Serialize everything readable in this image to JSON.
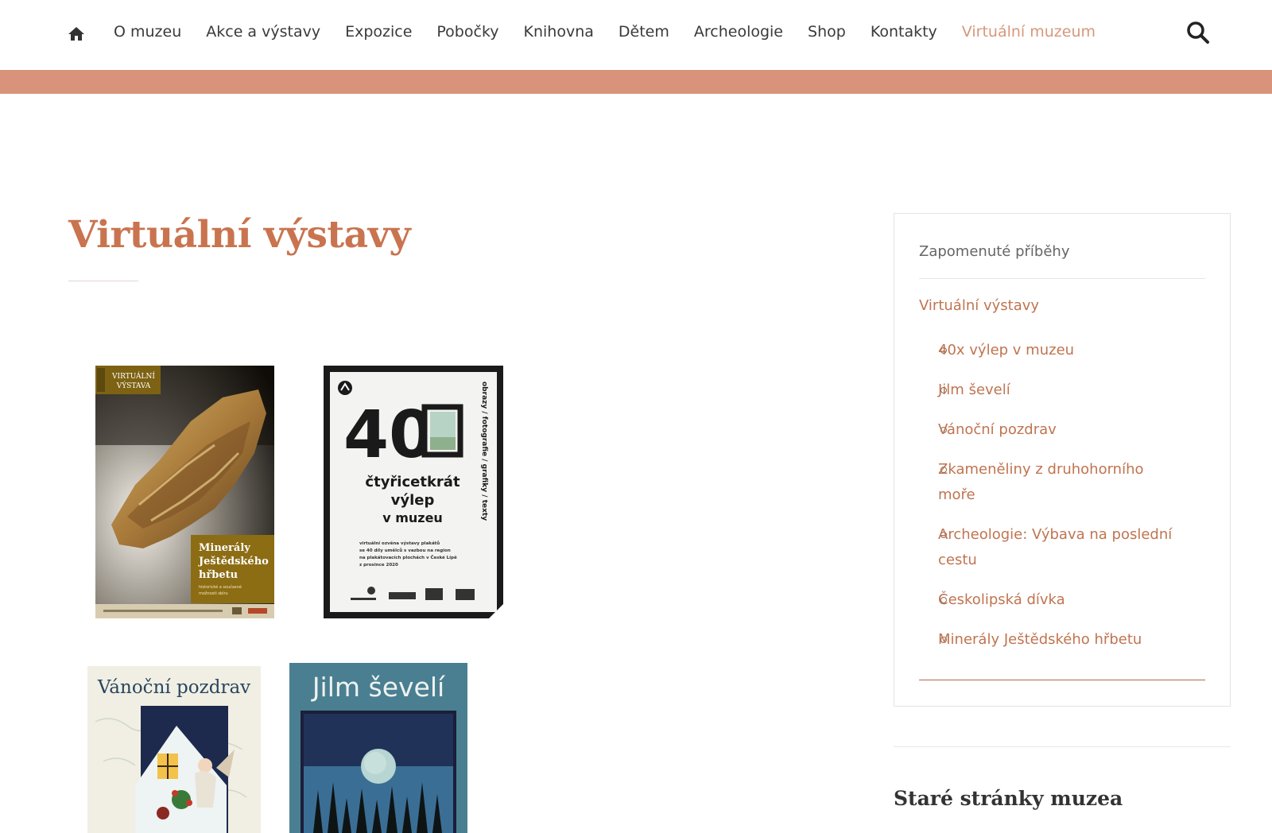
{
  "nav": {
    "items": [
      {
        "label": "O muzeu"
      },
      {
        "label": "Akce a výstavy"
      },
      {
        "label": "Expozice"
      },
      {
        "label": "Pobočky"
      },
      {
        "label": "Knihovna"
      },
      {
        "label": "Dětem"
      },
      {
        "label": "Archeologie"
      },
      {
        "label": "Shop"
      },
      {
        "label": "Kontakty"
      },
      {
        "label": "Virtuální muzeum",
        "active": true
      }
    ],
    "home_icon": "home-icon",
    "search_icon": "search-icon"
  },
  "colors": {
    "accent_band": "#d9937a",
    "title": "#c9744f",
    "link": "#c07450",
    "active_nav": "#d7977a"
  },
  "main": {
    "title": "Virtuální výstavy",
    "thumbnails": [
      {
        "badge_line1": "VIRTUÁLNÍ",
        "badge_line2": "VÝSTAVA",
        "caption_line1": "Minerály",
        "caption_line2": "Ještědského",
        "caption_line3": "hřbetu",
        "caption_sub1": "historické a současné",
        "caption_sub2": "možnosti sbíru"
      },
      {
        "big_number": "40",
        "line1": "čtyřicetkrát",
        "line2": "výlep",
        "line3": "v muzeu",
        "side_text": "obrazy / fotografie / grafiky / texty",
        "small1": "virtuální ozvěna výstavy plakátů",
        "small2": "se 40 díly umělců s vazbou na region",
        "small3": "na plakátovacích plochách v České Lípě",
        "small4": "z prosince 2020"
      },
      {
        "title": "Vánoční pozdrav"
      },
      {
        "title": "Jilm ševelí"
      }
    ]
  },
  "sidebar": {
    "top_link": "Zapomenuté příběhy",
    "current": "Virtuální výstavy",
    "items": [
      {
        "label": "40x výlep v muzeu"
      },
      {
        "label": "Jilm ševelí"
      },
      {
        "label": "Vánoční pozdrav"
      },
      {
        "label": "Zkameněliny z druhohorního moře"
      },
      {
        "label": "Archeologie: Výbava na poslední cestu"
      },
      {
        "label": "Českolipská dívka"
      },
      {
        "label": "Minerály Ještědského hřbetu"
      }
    ],
    "heading": "Staré stránky muzea"
  }
}
